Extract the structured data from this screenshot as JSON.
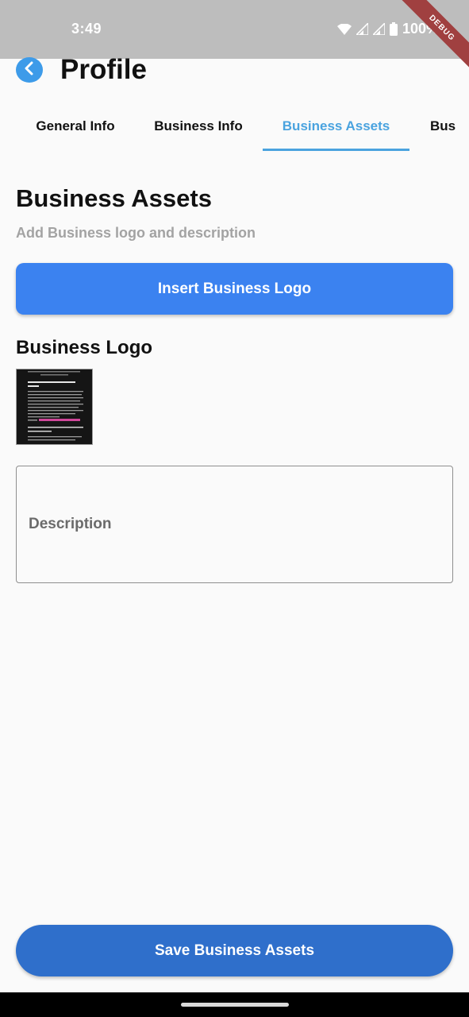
{
  "status_bar": {
    "time": "3:49",
    "battery": "100%",
    "icons": [
      "wifi-icon",
      "signal-icon",
      "signal-icon",
      "battery-icon"
    ]
  },
  "debug_banner": "DEBUG",
  "app_bar": {
    "title": "Profile",
    "back_icon": "chevron-left-icon"
  },
  "tabs": [
    {
      "label": "General Info"
    },
    {
      "label": "Business Info"
    },
    {
      "label": "Business Assets",
      "selected": true
    },
    {
      "label": "Bus"
    }
  ],
  "section": {
    "title": "Business Assets",
    "subtitle": "Add Business logo and description"
  },
  "insert_button": "Insert Business Logo",
  "logo_label": "Business Logo",
  "description": {
    "placeholder": "Description",
    "value": ""
  },
  "save_button": "Save Business Assets",
  "colors": {
    "accent": "#4aa3df",
    "primary_button": "#3b82f0",
    "save_button": "#2f6fcb",
    "status_bar": "#bdbdbd"
  }
}
